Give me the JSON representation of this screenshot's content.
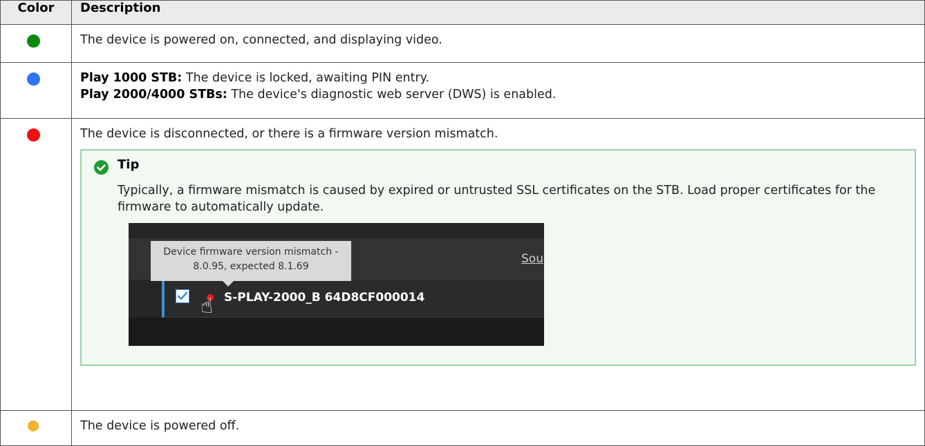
{
  "table": {
    "headers": {
      "color": "Color",
      "description": "Description"
    },
    "rows": [
      {
        "color_name": "green",
        "color_hex": "#0b8a0b",
        "text": "The device is powered on, connected, and displaying video."
      },
      {
        "color_name": "blue",
        "color_hex": "#2f74f0",
        "line1_bold": "Play 1000 STB:",
        "line1_text": " The device is locked, awaiting PIN entry.",
        "line2_bold": "Play 2000/4000 STBs:",
        "line2_text": " The device's diagnostic web server (DWS) is enabled."
      },
      {
        "color_name": "red",
        "color_hex": "#ee1111",
        "text": "The device is disconnected, or there is a firmware version mismatch."
      },
      {
        "color_name": "yellow",
        "color_hex": "#f2b431",
        "text": "The device is powered off."
      }
    ]
  },
  "tip": {
    "icon": "check-circle-icon",
    "title": "Tip",
    "text": "Typically, a firmware mismatch is caused by expired or untrusted SSL certificates on the STB. Load proper certificates for the firmware to automatically update.",
    "screenshot": {
      "tooltip_line1": "Device firmware version mismatch -",
      "tooltip_line2": "8.0.95, expected 8.1.69",
      "sort_label": "Sou",
      "device_name": "S-PLAY-2000_B 64D8CF000014",
      "hand_icon": "pointer-hand-icon",
      "status_dot_color": "#e31b1b"
    }
  }
}
